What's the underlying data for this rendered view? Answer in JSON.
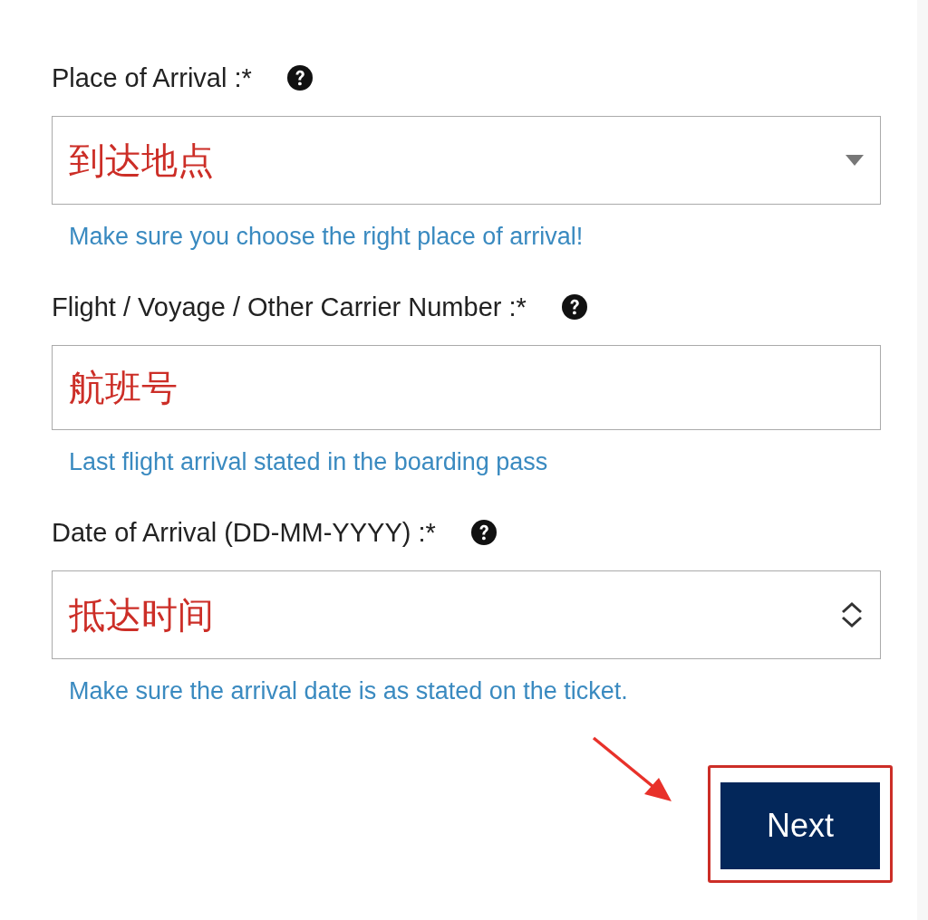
{
  "fields": [
    {
      "kind": "select",
      "label": "Place of Arrival :*",
      "value": "到达地点",
      "hint": "Make sure you choose the right place of arrival!"
    },
    {
      "kind": "text",
      "label": "Flight / Voyage / Other Carrier Number :*",
      "value": "航班号",
      "hint": "Last flight arrival stated in the boarding pass"
    },
    {
      "kind": "date",
      "label": "Date of Arrival (DD-MM-YYYY) :*",
      "value": "抵达时间",
      "hint": "Make sure the arrival date is as stated on the ticket."
    }
  ],
  "next_button": {
    "label": "Next",
    "highlighted": true
  }
}
